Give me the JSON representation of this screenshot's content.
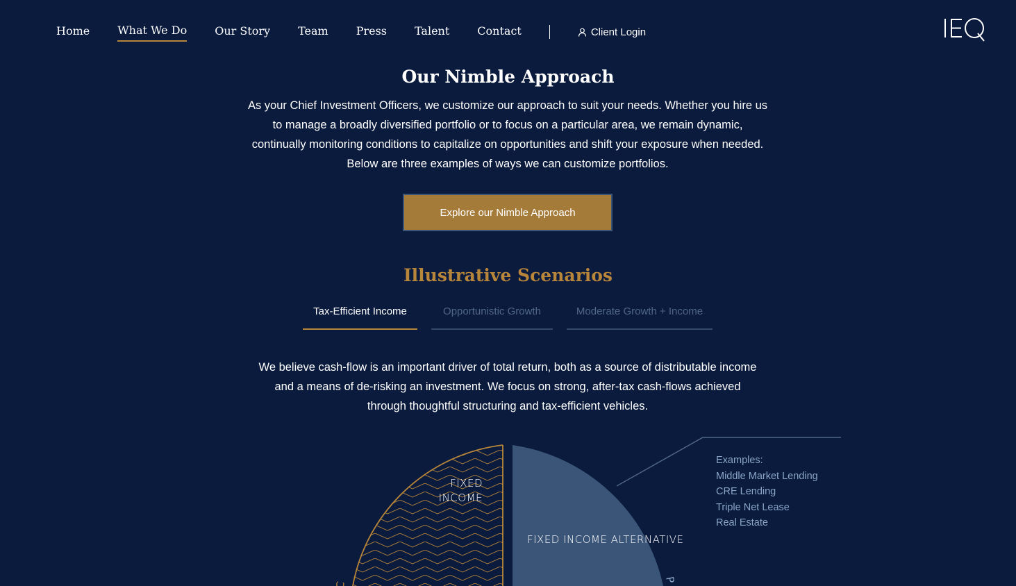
{
  "nav": {
    "links": [
      "Home",
      "What We Do",
      "Our Story",
      "Team",
      "Press",
      "Talent",
      "Contact"
    ],
    "active_index": 1,
    "client_login": "Client Login",
    "logo": "IEQ"
  },
  "approach": {
    "title": "Our Nimble Approach",
    "text": "As your Chief Investment Officers, we customize our approach to suit your needs. Whether you hire us to manage a broadly diversified portfolio or to focus on a particular area, we remain dynamic, continually monitoring conditions to capitalize on opportunities and shift your exposure when needed. Below are three examples of ways we can customize portfolios.",
    "button": "Explore our Nimble Approach"
  },
  "scenarios": {
    "title": "Illustrative Scenarios",
    "tabs": [
      "Tax-Efficient Income",
      "Opportunistic Growth",
      "Moderate Growth + Income"
    ],
    "active_tab": 0,
    "text": "We believe cash-flow is an important driver of total return, both as a source of distributable income and a means of de-risking an investment. We focus on strong, after-tax cash-flows achieved through thoughtful structuring and tax-efficient vehicles."
  },
  "pie": {
    "slices": {
      "fixed_income": "FIXED INCOME",
      "fixed_income_alternative": "FIXED INCOME ALTERNATIVE"
    },
    "examples": {
      "heading": "Examples:",
      "items": [
        "Middle Market Lending",
        "CRE Lending",
        "Triple Net Lease",
        "Real Estate"
      ]
    },
    "colors": {
      "gold": "#b8863a",
      "slate": "#3a5578"
    }
  }
}
